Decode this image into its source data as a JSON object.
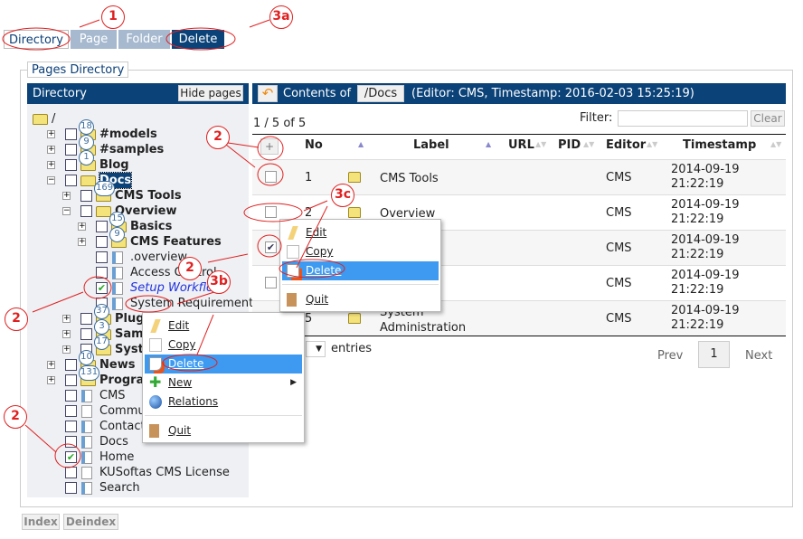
{
  "tabs": [
    {
      "label": "Directory",
      "active": true
    },
    {
      "label": "Page"
    },
    {
      "label": "Folder"
    },
    {
      "label": "Delete"
    }
  ],
  "legend": "Pages Directory",
  "left": {
    "title": "Directory",
    "hide_button": "Hide pages"
  },
  "tree": [
    {
      "label": "/",
      "level": 0,
      "type": "folder-open"
    },
    {
      "label": "#models",
      "level": 1,
      "type": "folder",
      "exp": "+",
      "badge": "18",
      "bold": true
    },
    {
      "label": "#samples",
      "level": 1,
      "type": "folder",
      "exp": "+",
      "badge": "9",
      "bold": true
    },
    {
      "label": "Blog",
      "level": 1,
      "type": "folder",
      "exp": "+",
      "badge": "1",
      "bold": true
    },
    {
      "label": "Docs",
      "level": 1,
      "type": "folder-open",
      "exp": "−",
      "bold": true,
      "selected": true
    },
    {
      "label": "CMS Tools",
      "level": 2,
      "type": "folder",
      "exp": "+",
      "badge": "169",
      "bold": true
    },
    {
      "label": "Overview",
      "level": 2,
      "type": "folder-open",
      "exp": "−",
      "bold": true
    },
    {
      "label": "Basics",
      "level": 3,
      "type": "folder",
      "exp": "+",
      "badge": "15",
      "bold": true
    },
    {
      "label": "CMS Features",
      "level": 3,
      "type": "folder",
      "exp": "+",
      "badge": "9",
      "bold": true
    },
    {
      "label": ".overview",
      "level": 3,
      "type": "page-m"
    },
    {
      "label": "Access Control",
      "level": 3,
      "type": "page-m"
    },
    {
      "label": "Setup Workflow",
      "level": 3,
      "type": "page-m",
      "italic": true,
      "checked": true
    },
    {
      "label": "System Requirements",
      "level": 3,
      "type": "page-m"
    },
    {
      "label": "Plugins",
      "level": 2,
      "type": "folder",
      "exp": "+",
      "badge": "37",
      "bold": true
    },
    {
      "label": "Samples",
      "level": 2,
      "type": "folder",
      "exp": "+",
      "badge": "3",
      "bold": true
    },
    {
      "label": "System",
      "level": 2,
      "type": "folder",
      "exp": "+",
      "badge": "17",
      "bold": true
    },
    {
      "label": "News",
      "level": 1,
      "type": "folder",
      "exp": "+",
      "badge": "10",
      "bold": true
    },
    {
      "label": "Programs",
      "level": 1,
      "type": "folder",
      "exp": "+",
      "badge": "131",
      "bold": true
    },
    {
      "label": "CMS",
      "level": 1,
      "type": "page-m"
    },
    {
      "label": "Community",
      "level": 1,
      "type": "page"
    },
    {
      "label": "Contacts",
      "level": 1,
      "type": "page-m"
    },
    {
      "label": "Docs",
      "level": 1,
      "type": "page-m"
    },
    {
      "label": "Home",
      "level": 1,
      "type": "page-m",
      "checked": true
    },
    {
      "label": "KUSoftas CMS License",
      "level": 1,
      "type": "page"
    },
    {
      "label": "Search",
      "level": 1,
      "type": "page-m"
    }
  ],
  "right": {
    "contents_of": "Contents of",
    "path": "/Docs",
    "info": "(Editor: CMS, Timestamp: 2016-02-03 15:25:19)",
    "count": "1 / 5 of 5",
    "filter_label": "Filter:",
    "filter_value": "",
    "clear": "Clear"
  },
  "table": {
    "add": "+",
    "columns": [
      "No",
      "Label",
      "URL",
      "PID",
      "Editor",
      "Timestamp"
    ],
    "rows": [
      {
        "no": "1",
        "label": "CMS Tools",
        "editor": "CMS",
        "ts1": "2014-09-19",
        "ts2": "21:22:19"
      },
      {
        "no": "2",
        "label": "Overview",
        "editor": "CMS",
        "ts1": "2014-09-19",
        "ts2": "21:22:19",
        "checked": false
      },
      {
        "no": "",
        "label": "",
        "editor": "CMS",
        "ts1": "2014-09-19",
        "ts2": "21:22:19",
        "checked": true
      },
      {
        "no": "",
        "label": "",
        "editor": "CMS",
        "ts1": "2014-09-19",
        "ts2": "21:22:19"
      },
      {
        "no": "5",
        "label": "System Administration",
        "editor": "CMS",
        "ts1": "2014-09-19",
        "ts2": "21:22:19"
      }
    ],
    "entries": "entries",
    "prev": "Prev",
    "page": "1",
    "next": "Next"
  },
  "menu_tree": {
    "items": [
      "Edit",
      "Copy",
      "Delete",
      "New",
      "Relations",
      "Quit"
    ]
  },
  "menu_table": {
    "items": [
      "Edit",
      "Copy",
      "Delete",
      "Quit"
    ]
  },
  "footer": {
    "index": "Index",
    "deindex": "Deindex"
  },
  "annotations": [
    "1",
    "2",
    "2",
    "2",
    "2",
    "3a",
    "3b",
    "3c"
  ]
}
